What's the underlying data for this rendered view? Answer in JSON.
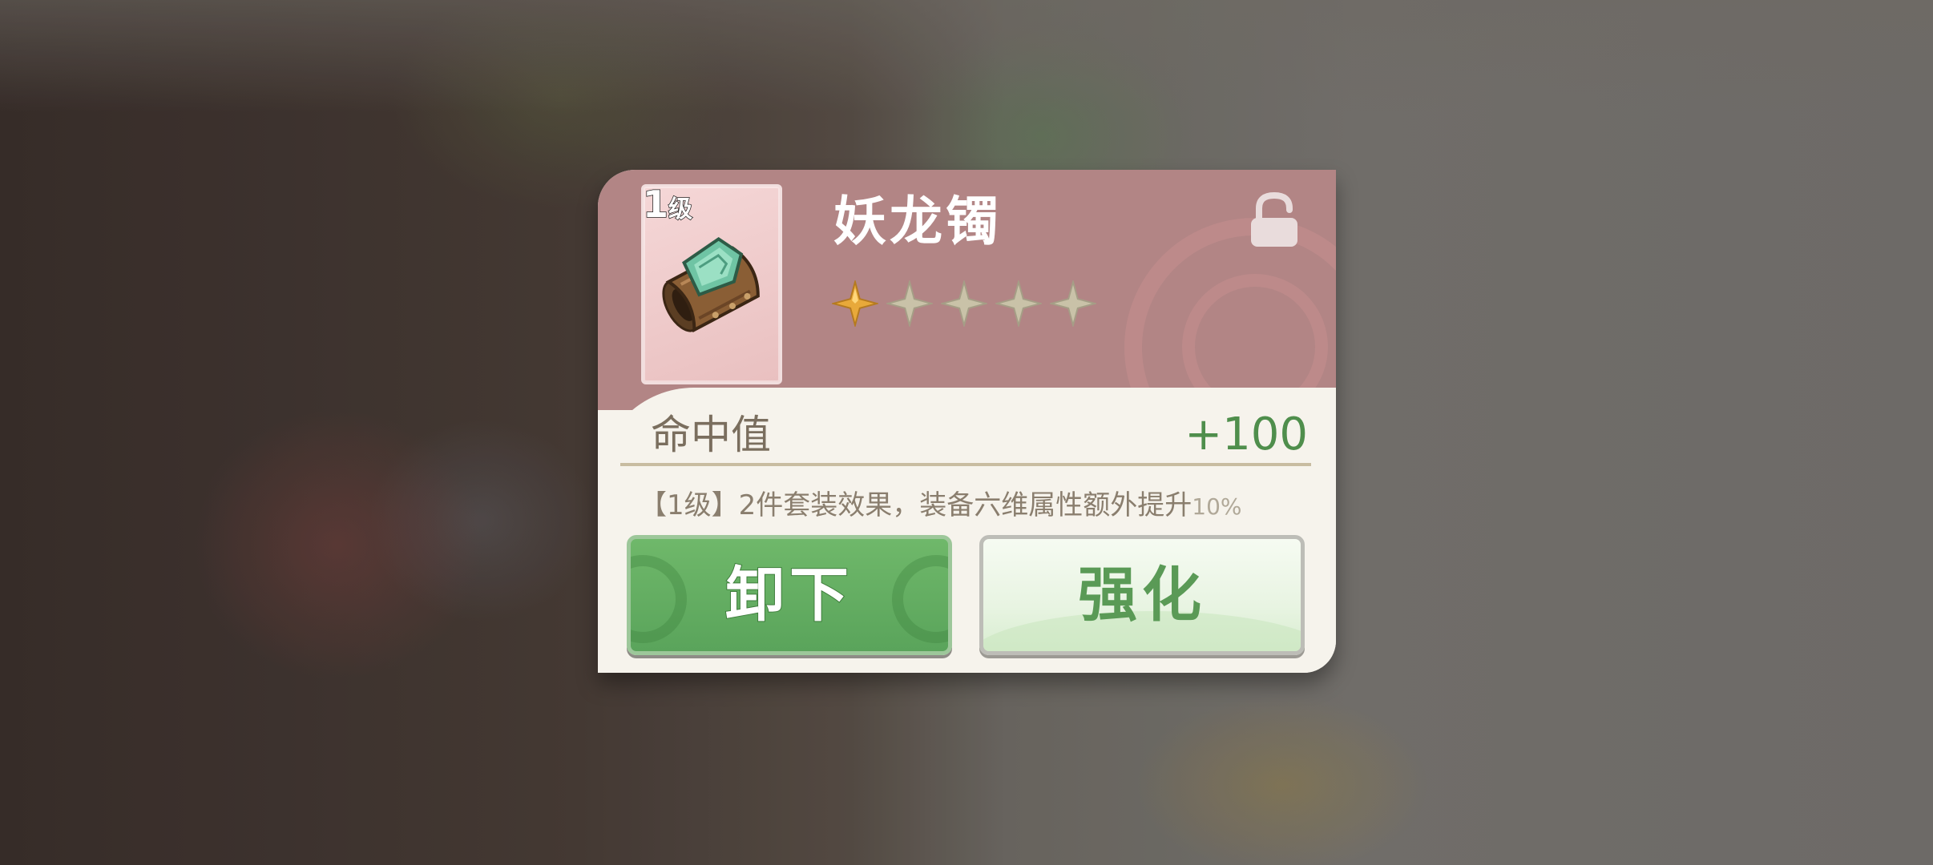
{
  "item": {
    "level_number": "1",
    "level_unit": "级",
    "name": "妖龙镯",
    "rarity": {
      "filled": 1,
      "total": 5
    },
    "icon": "bracelet-icon",
    "locked": false
  },
  "stat": {
    "label": "命中值",
    "value": "+100"
  },
  "set_effect": {
    "text": "【1级】2件套装效果，装备六维属性额外提升",
    "percent": "10%"
  },
  "buttons": {
    "unequip_label": "卸下",
    "enhance_label": "强化"
  },
  "colors": {
    "header": "#b28585",
    "body": "#f6f3ec",
    "star_active": "#e8a93a",
    "star_inactive": "#c9c2a8",
    "accent_green": "#5aa45b",
    "stat_value": "#4f8e4c"
  }
}
